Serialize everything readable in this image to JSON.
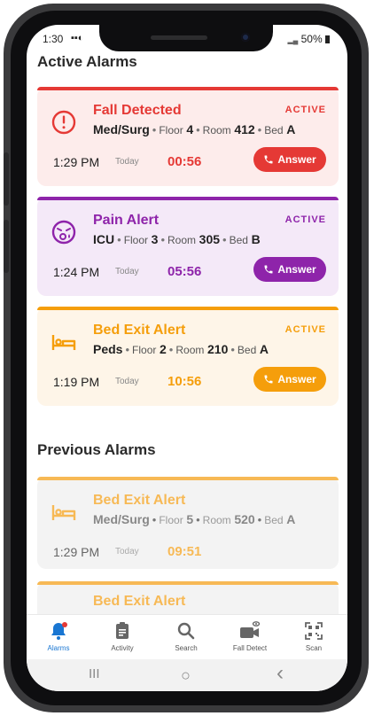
{
  "status": {
    "time": "1:30",
    "icons": "▪▪◐",
    "battery": "50%"
  },
  "active_section": {
    "title": "Active Alarms"
  },
  "previous_section": {
    "title": "Previous Alarms"
  },
  "alarms_active": [
    {
      "title": "Fall Detected",
      "badge": "ACTIVE",
      "unit": "Med/Surg",
      "floor_label": "Floor",
      "floor": "4",
      "room_label": "Room",
      "room": "412",
      "bed_label": "Bed",
      "bed": "A",
      "time": "1:29 PM",
      "day": "Today",
      "elapsed": "00:56",
      "answer": "Answer",
      "accent": "#e53935",
      "bg": "#fdeceb",
      "icon": "alert-circle-icon"
    },
    {
      "title": "Pain Alert",
      "badge": "ACTIVE",
      "unit": "ICU",
      "floor_label": "Floor",
      "floor": "3",
      "room_label": "Room",
      "room": "305",
      "bed_label": "Bed",
      "bed": "B",
      "time": "1:24 PM",
      "day": "Today",
      "elapsed": "05:56",
      "answer": "Answer",
      "accent": "#8e24aa",
      "bg": "#f4e9f8",
      "icon": "pain-face-icon"
    },
    {
      "title": "Bed Exit Alert",
      "badge": "ACTIVE",
      "unit": "Peds",
      "floor_label": "Floor",
      "floor": "2",
      "room_label": "Room",
      "room": "210",
      "bed_label": "Bed",
      "bed": "A",
      "time": "1:19 PM",
      "day": "Today",
      "elapsed": "10:56",
      "answer": "Answer",
      "accent": "#f59e0b",
      "bg": "#fef5e8",
      "icon": "bed-icon"
    }
  ],
  "alarms_previous": [
    {
      "title": "Bed Exit Alert",
      "unit": "Med/Surg",
      "floor_label": "Floor",
      "floor": "5",
      "room_label": "Room",
      "room": "520",
      "bed_label": "Bed",
      "bed": "A",
      "time": "1:29 PM",
      "day": "Today",
      "elapsed": "09:51",
      "accent": "#f7b955",
      "bg": "#f3f3f3",
      "icon": "bed-icon"
    },
    {
      "title": "Bed Exit Alert",
      "accent": "#f7b955",
      "bg": "#f3f3f3"
    }
  ],
  "tabs": [
    {
      "label": "Alarms",
      "icon": "bell-icon"
    },
    {
      "label": "Activity",
      "icon": "clipboard-icon"
    },
    {
      "label": "Search",
      "icon": "search-icon"
    },
    {
      "label": "Fall Detect",
      "icon": "camera-icon"
    },
    {
      "label": "Scan",
      "icon": "qr-code-icon"
    }
  ],
  "system_nav": {
    "recents": "III",
    "home": "○",
    "back": "‹"
  },
  "colors": {
    "tab_active": "#1976d2",
    "alert_dot": "#e53935"
  }
}
